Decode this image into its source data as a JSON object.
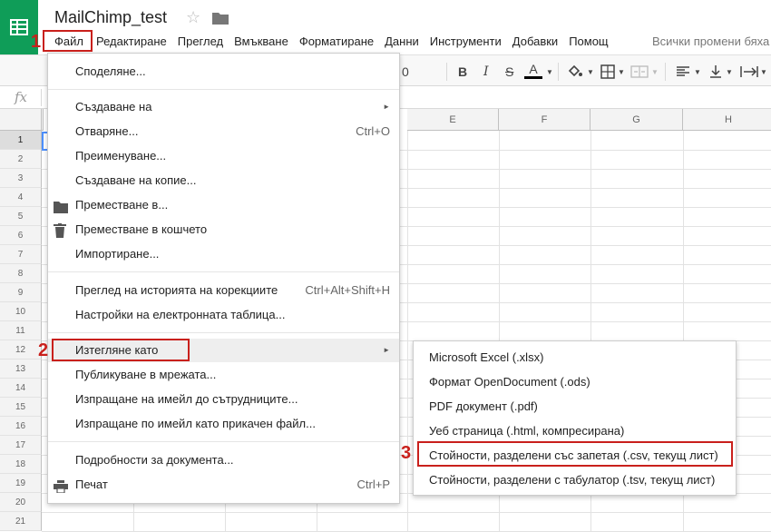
{
  "app": {
    "title": "MailChimp_test",
    "saved_status": "Всички промени бяха"
  },
  "menubar": {
    "items": [
      "Файл",
      "Редактиране",
      "Преглед",
      "Вмъкване",
      "Форматиране",
      "Данни",
      "Инструменти",
      "Добавки",
      "Помощ"
    ]
  },
  "toolbar": {
    "font_size": "0",
    "bold": "B",
    "italic": "I",
    "strike": "S",
    "text_color": "A"
  },
  "formula_bar": {
    "fx": "fx"
  },
  "grid": {
    "columns": [
      "E",
      "F",
      "G",
      "H"
    ],
    "rows": [
      "1",
      "2",
      "3",
      "4",
      "5",
      "6",
      "7",
      "8",
      "9",
      "10",
      "11",
      "12",
      "13",
      "14",
      "15",
      "16",
      "17",
      "18",
      "19",
      "20",
      "21"
    ]
  },
  "file_menu": {
    "items": [
      {
        "label": "Споделяне...",
        "shortcut": ""
      },
      {
        "label": "Създаване на",
        "shortcut": "",
        "submenu": true
      },
      {
        "label": "Отваряне...",
        "shortcut": "Ctrl+O"
      },
      {
        "label": "Преименуване...",
        "shortcut": ""
      },
      {
        "label": "Създаване на копие...",
        "shortcut": ""
      },
      {
        "label": "Преместване в...",
        "shortcut": "",
        "icon": "folder-icon"
      },
      {
        "label": "Преместване в кошчето",
        "shortcut": "",
        "icon": "trash-icon"
      },
      {
        "label": "Импортиране...",
        "shortcut": ""
      },
      {
        "label": "Преглед на историята на корекциите",
        "shortcut": "Ctrl+Alt+Shift+H"
      },
      {
        "label": "Настройки на електронната таблица...",
        "shortcut": ""
      },
      {
        "label": "Изтегляне като",
        "shortcut": "",
        "submenu": true
      },
      {
        "label": "Публикуване в мрежата...",
        "shortcut": ""
      },
      {
        "label": "Изпращане на имейл до сътрудниците...",
        "shortcut": ""
      },
      {
        "label": "Изпращане по имейл като прикачен файл...",
        "shortcut": ""
      },
      {
        "label": "Подробности за документа...",
        "shortcut": ""
      },
      {
        "label": "Печат",
        "shortcut": "Ctrl+P",
        "icon": "printer-icon"
      }
    ]
  },
  "download_submenu": {
    "items": [
      "Microsoft Excel (.xlsx)",
      "Формат OpenDocument (.ods)",
      "PDF документ (.pdf)",
      "Уеб страница (.html, компресирана)",
      "Стойности, разделени със запетая (.csv, текущ лист)",
      "Стойности, разделени с табулатор (.tsv, текущ лист)"
    ]
  },
  "annotations": {
    "step1": "1",
    "step2": "2",
    "step3": "3"
  },
  "colors": {
    "logo_green": "#0f9d58",
    "annotation_red": "#c9201c",
    "selection_blue": "#4d90fe"
  }
}
